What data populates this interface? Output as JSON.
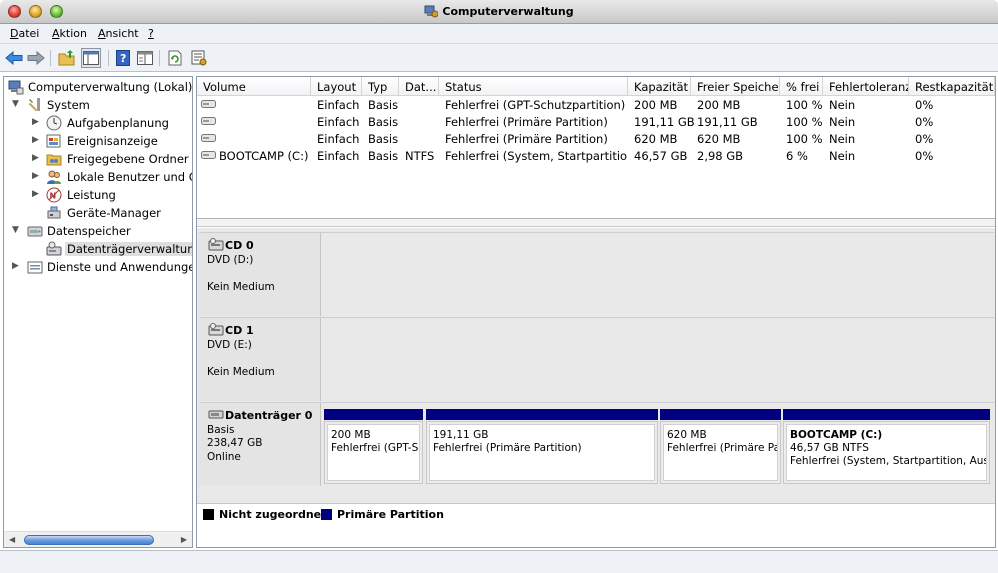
{
  "window": {
    "title": "Computerverwaltung"
  },
  "menu": [
    {
      "label": "Datei",
      "u": "D",
      "rest": "atei"
    },
    {
      "label": "Aktion",
      "u": "A",
      "rest": "ktion"
    },
    {
      "label": "Ansicht",
      "u": "A",
      "rest": "nsicht"
    },
    {
      "label": "?",
      "u": "?",
      "rest": ""
    }
  ],
  "toolbar": {
    "buttons": [
      "back-icon",
      "forward-icon",
      "up-folder-icon",
      "show-tree-icon",
      "help-icon",
      "properties-icon",
      "refresh-icon",
      "settings-icon"
    ]
  },
  "tree": {
    "root": "Computerverwaltung (Lokal)",
    "system": "System",
    "aufgabenplanung": "Aufgabenplanung",
    "ereignisanzeige": "Ereignisanzeige",
    "freigegebene": "Freigegebene Ordner",
    "lokale": "Lokale Benutzer und Gruppen",
    "leistung": "Leistung",
    "geraete": "Geräte-Manager",
    "datenspeicher": "Datenspeicher",
    "datentraeger": "Datenträgerverwaltung",
    "dienste": "Dienste und Anwendungen"
  },
  "volumes": {
    "headers": [
      "Volume",
      "Layout",
      "Typ",
      "Dat...",
      "Status",
      "Kapazität",
      "Freier Speicher",
      "% frei",
      "Fehlertoleranz",
      "Restkapazität"
    ],
    "rows": [
      {
        "volume": "",
        "layout": "Einfach",
        "typ": "Basis",
        "dat": "",
        "status": "Fehlerfrei (GPT-Schutzpartition)",
        "kap": "200 MB",
        "frei": "200 MB",
        "pct": "100 %",
        "fehler": "Nein",
        "rest": "0%"
      },
      {
        "volume": "",
        "layout": "Einfach",
        "typ": "Basis",
        "dat": "",
        "status": "Fehlerfrei (Primäre Partition)",
        "kap": "191,11 GB",
        "frei": "191,11 GB",
        "pct": "100 %",
        "fehler": "Nein",
        "rest": "0%"
      },
      {
        "volume": "",
        "layout": "Einfach",
        "typ": "Basis",
        "dat": "",
        "status": "Fehlerfrei (Primäre Partition)",
        "kap": "620 MB",
        "frei": "620 MB",
        "pct": "100 %",
        "fehler": "Nein",
        "rest": "0%"
      },
      {
        "volume": "BOOTCAMP (C:)",
        "layout": "Einfach",
        "typ": "Basis",
        "dat": "NTFS",
        "status": "Fehlerfrei (System, Startpartition, Auslagerungsdatei)",
        "kap": "46,57 GB",
        "frei": "2,98 GB",
        "pct": "6 %",
        "fehler": "Nein",
        "rest": "0%"
      }
    ]
  },
  "disks": [
    {
      "name": "CD 0",
      "line1": "DVD (D:)",
      "line2": "",
      "line3": "Kein Medium"
    },
    {
      "name": "CD 1",
      "line1": "DVD (E:)",
      "line2": "",
      "line3": "Kein Medium"
    },
    {
      "name": "Datenträger 0",
      "line1": "Basis",
      "line2": "238,47 GB",
      "line3": "Online"
    }
  ],
  "partitions": [
    {
      "title": "",
      "size": "200 MB",
      "status": "Fehlerfrei (GPT-Schutzpartition)"
    },
    {
      "title": "",
      "size": "191,11 GB",
      "status": "Fehlerfrei (Primäre Partition)"
    },
    {
      "title": "",
      "size": "620 MB",
      "status": "Fehlerfrei (Primäre Partition)"
    },
    {
      "title": "BOOTCAMP  (C:)",
      "size": "46,57 GB NTFS",
      "status": "Fehlerfrei (System, Startpartition, Auslagerungsdatei)"
    }
  ],
  "legend": [
    {
      "label": "Nicht zugeordnet",
      "color": "#000000"
    },
    {
      "label": "Primäre Partition",
      "color": "#000080"
    }
  ],
  "colors": {
    "primary_partition": "#000080",
    "unallocated": "#000000"
  }
}
